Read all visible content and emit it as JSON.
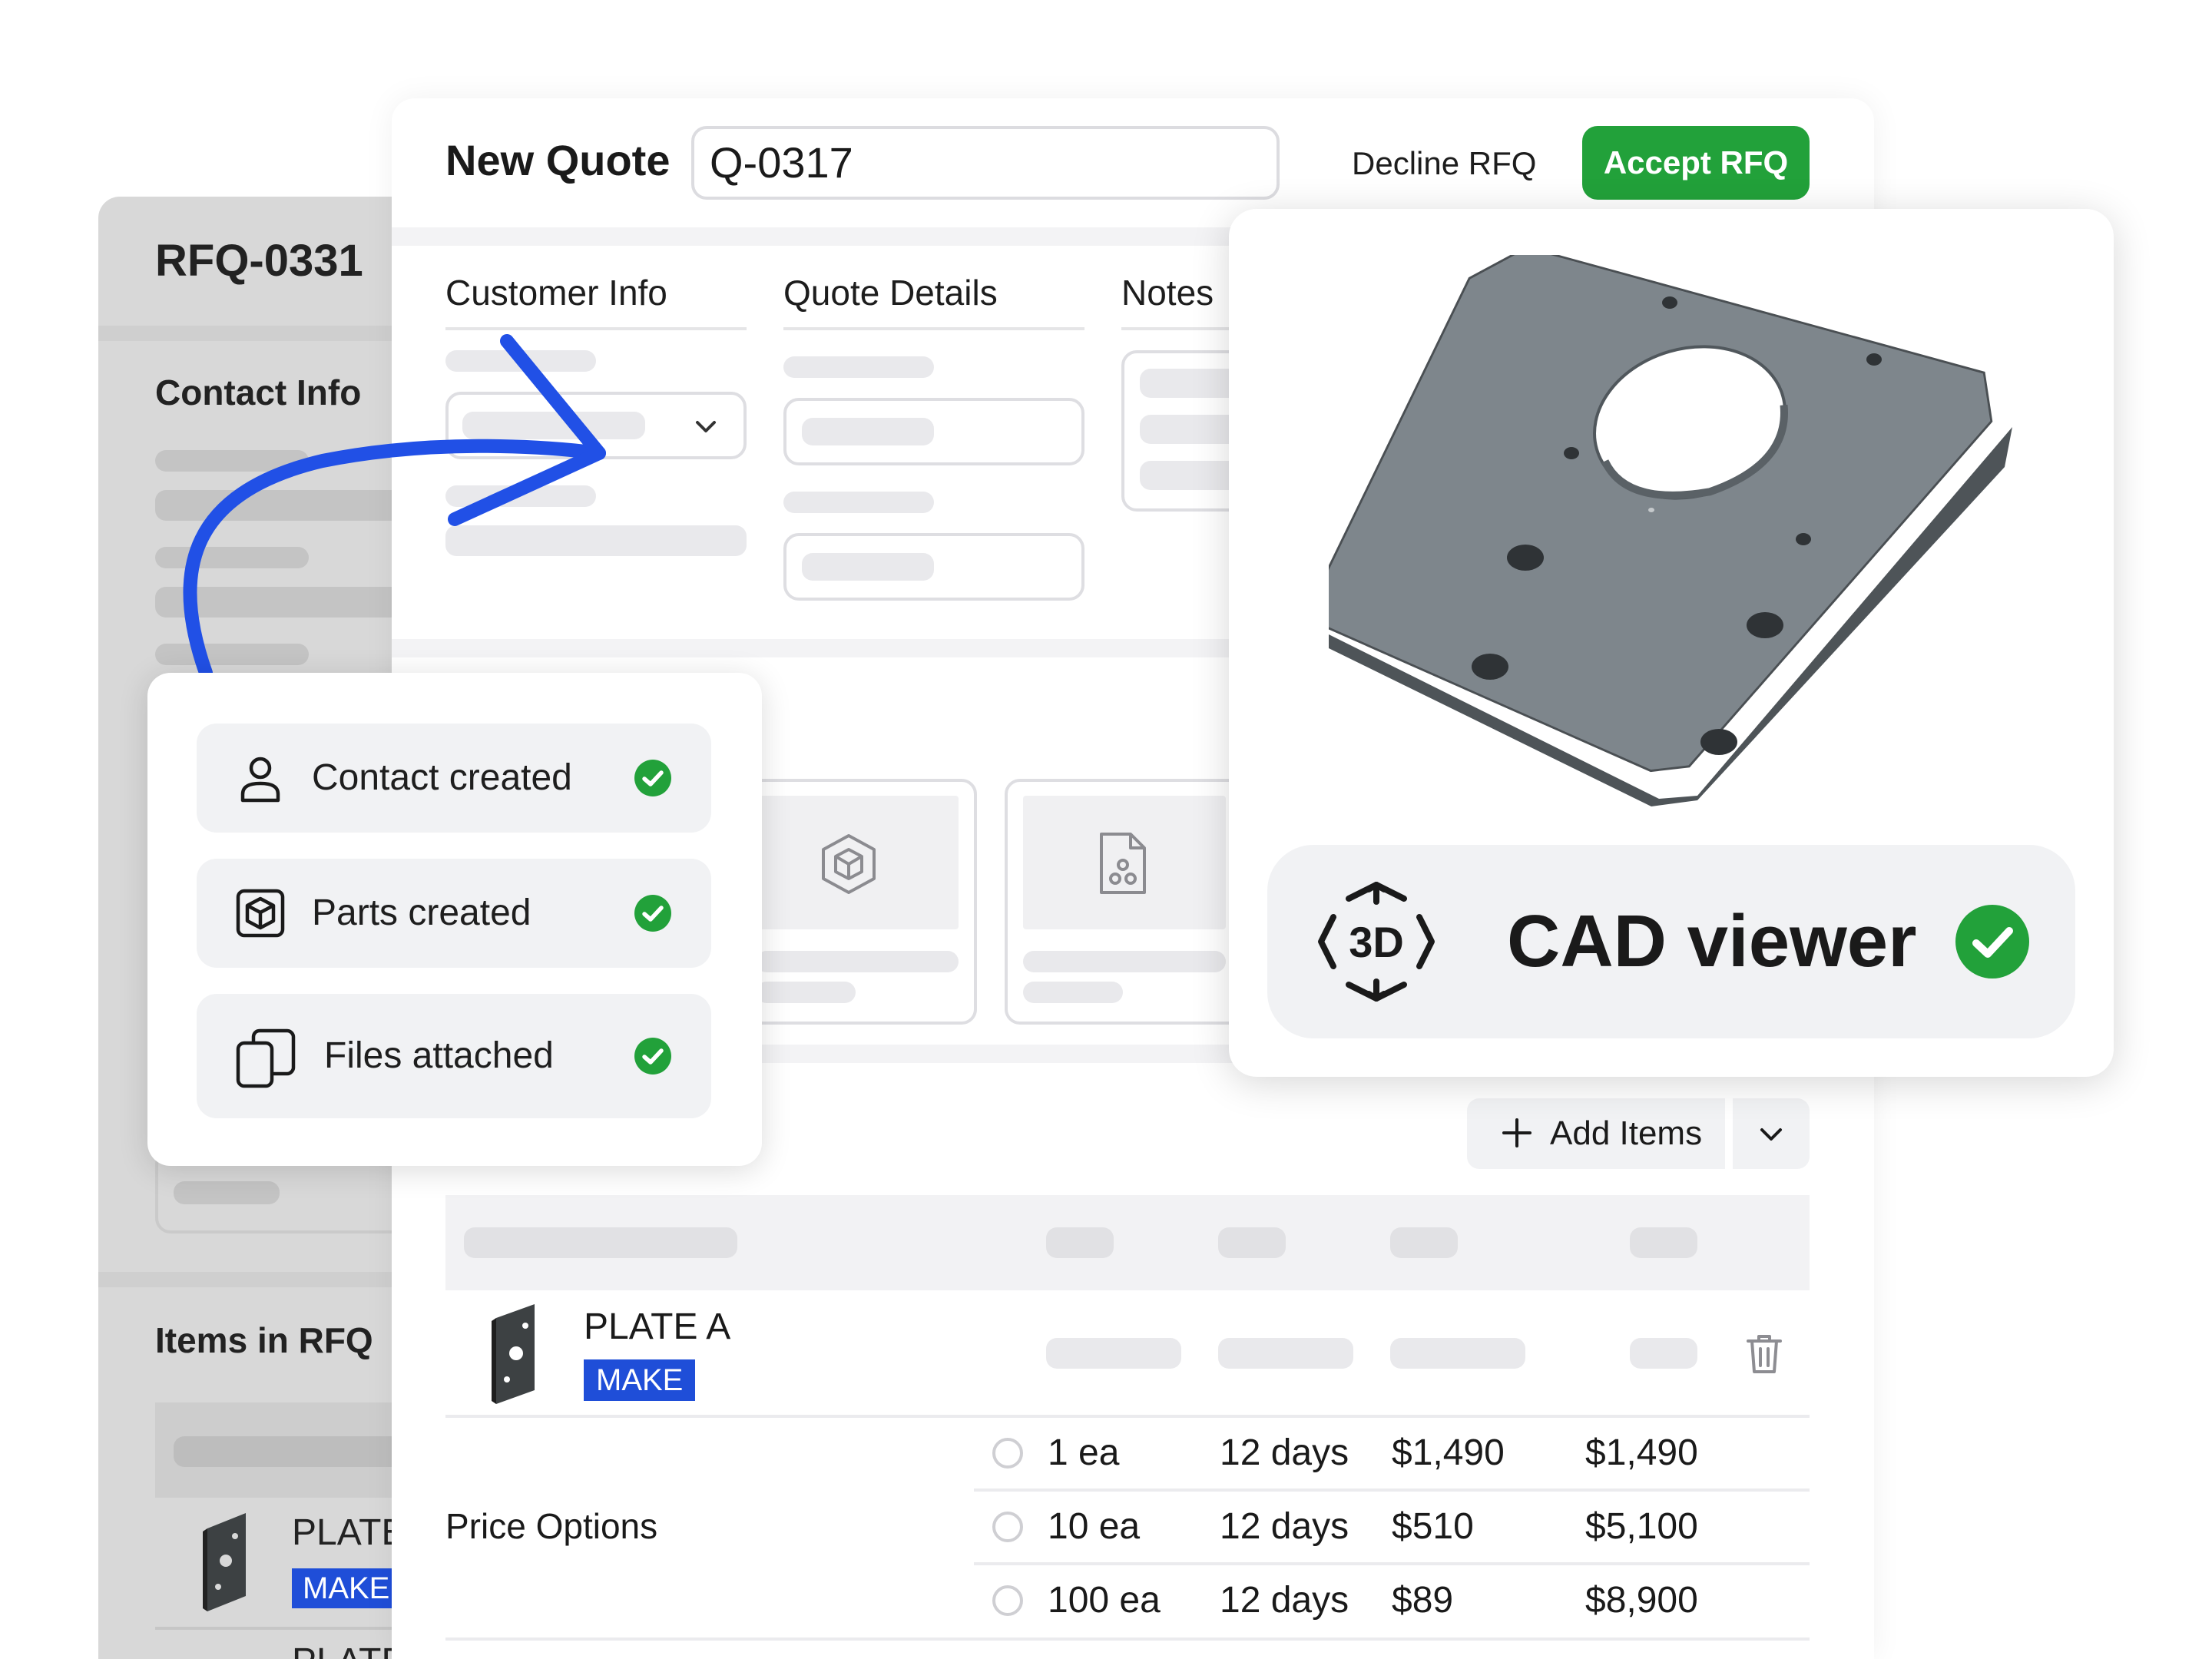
{
  "rfq": {
    "id": "RFQ-0331",
    "contact_heading": "Contact Info",
    "items_heading": "Items in RFQ",
    "item_name": "PLATE A",
    "item_tag": "MAKE",
    "next_item_name": "PLATE B"
  },
  "quote": {
    "title": "New Quote",
    "number": "Q-0317",
    "decline_label": "Decline RFQ",
    "accept_label": "Accept RFQ",
    "tabs": [
      "Customer Info",
      "Quote Details",
      "Notes"
    ],
    "add_items_label": "Add Items",
    "line_item": {
      "name": "PLATE A",
      "tag": "MAKE"
    },
    "price_options_label": "Price Options",
    "price_options": [
      {
        "qty": "1 ea",
        "lead": "12 days",
        "unit": "$1,490",
        "total": "$1,490"
      },
      {
        "qty": "10 ea",
        "lead": "12 days",
        "unit": "$510",
        "total": "$5,100"
      },
      {
        "qty": "100 ea",
        "lead": "12 days",
        "unit": "$89",
        "total": "$8,900"
      }
    ]
  },
  "checklist": [
    {
      "label": "Contact created",
      "icon": "user-icon"
    },
    {
      "label": "Parts created",
      "icon": "cube-box-icon"
    },
    {
      "label": "Files attached",
      "icon": "files-icon"
    }
  ],
  "cad": {
    "label": "CAD viewer",
    "badge_icon": "3d-icon",
    "icon_text": "3D"
  },
  "colors": {
    "accent_green": "#22a13a",
    "tag_blue": "#1f4ed8",
    "arrow_blue": "#2150e6",
    "panel_gray": "#d8d8d8"
  }
}
